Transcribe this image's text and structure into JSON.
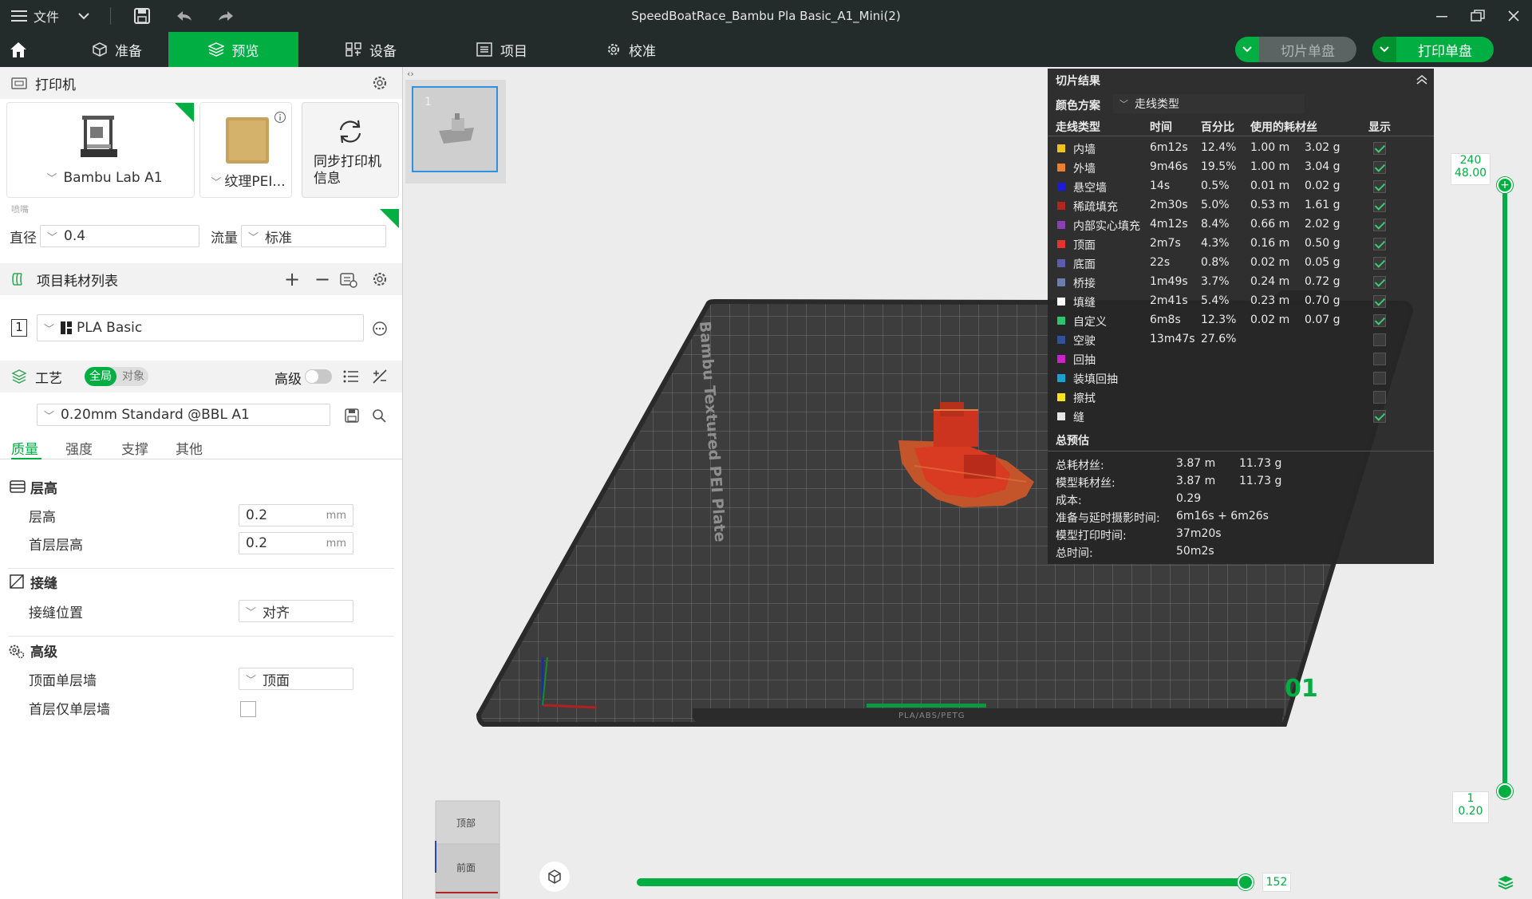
{
  "window": {
    "title": "SpeedBoatRace_Bambu Pla Basic_A1_Mini(2)",
    "file_menu": "文件"
  },
  "tabs": [
    {
      "label": "准备"
    },
    {
      "label": "预览"
    },
    {
      "label": "设备"
    },
    {
      "label": "项目"
    },
    {
      "label": "校准"
    }
  ],
  "actions": {
    "slice_label": "切片单盘",
    "print_label": "打印单盘"
  },
  "printer": {
    "section_title": "打印机",
    "printer_name": "Bambu Lab A1",
    "plate_name": "纹理PEI...",
    "sync_label": "同步打印机信息",
    "nozzle_caption": "喷嘴",
    "diameter_label": "直径",
    "diameter_value": "0.4",
    "flow_label": "流量",
    "flow_value": "标准"
  },
  "filament": {
    "section_title": "项目耗材列表",
    "slot": "1",
    "name": "PLA Basic"
  },
  "process": {
    "section_title": "工艺",
    "toggle_global": "全局",
    "toggle_object": "对象",
    "advanced_label": "高级",
    "preset": "0.20mm Standard @BBL A1",
    "subtabs": [
      "质量",
      "强度",
      "支撑",
      "其他"
    ],
    "layer_group": "层高",
    "layer_height_label": "层高",
    "layer_height_value": "0.2",
    "first_layer_label": "首层层高",
    "first_layer_value": "0.2",
    "unit": "mm",
    "seam_group": "接缝",
    "seam_label": "接缝位置",
    "seam_value": "对齐",
    "adv_group": "高级",
    "top_wall_label": "顶面单层墙",
    "top_wall_value": "顶面",
    "first_wall_label": "首层仅单层墙"
  },
  "plate": {
    "thumb_index": "1",
    "bed_label": "Bambu Textured PEI Plate",
    "plate_number": "01",
    "front_label": "PLA/ABS/PETG",
    "cube_top": "顶部",
    "cube_front": "前面"
  },
  "slice_result": {
    "title": "切片结果",
    "color_scheme_label": "颜色方案",
    "color_scheme_value": "走线类型",
    "headers": {
      "type": "走线类型",
      "time": "时间",
      "percent": "百分比",
      "used": "使用的耗材丝",
      "show": "显示"
    },
    "rows": [
      {
        "color": "#f2c21b",
        "name": "内墙",
        "time": "6m12s",
        "percent": "12.4%",
        "length": "1.00 m",
        "weight": "3.02 g",
        "shown": true
      },
      {
        "color": "#f07f2c",
        "name": "外墙",
        "time": "9m46s",
        "percent": "19.5%",
        "length": "1.00 m",
        "weight": "3.04 g",
        "shown": true
      },
      {
        "color": "#1b1bdb",
        "name": "悬空墙",
        "time": "14s",
        "percent": "0.5%",
        "length": "0.01 m",
        "weight": "0.02 g",
        "shown": true
      },
      {
        "color": "#b3261e",
        "name": "稀疏填充",
        "time": "2m30s",
        "percent": "5.0%",
        "length": "0.53 m",
        "weight": "1.61 g",
        "shown": true
      },
      {
        "color": "#8a3fb6",
        "name": "内部实心填充",
        "time": "4m12s",
        "percent": "8.4%",
        "length": "0.66 m",
        "weight": "2.02 g",
        "shown": true
      },
      {
        "color": "#e8322c",
        "name": "顶面",
        "time": "2m7s",
        "percent": "4.3%",
        "length": "0.16 m",
        "weight": "0.50 g",
        "shown": true
      },
      {
        "color": "#5b5bb0",
        "name": "底面",
        "time": "22s",
        "percent": "0.8%",
        "length": "0.02 m",
        "weight": "0.05 g",
        "shown": true
      },
      {
        "color": "#6b7fae",
        "name": "桥接",
        "time": "1m49s",
        "percent": "3.7%",
        "length": "0.24 m",
        "weight": "0.72 g",
        "shown": true
      },
      {
        "color": "#ffffff",
        "name": "填缝",
        "time": "2m41s",
        "percent": "5.4%",
        "length": "0.23 m",
        "weight": "0.70 g",
        "shown": true
      },
      {
        "color": "#2fc36e",
        "name": "自定义",
        "time": "6m8s",
        "percent": "12.3%",
        "length": "0.02 m",
        "weight": "0.07 g",
        "shown": true
      },
      {
        "color": "#3050a0",
        "name": "空驶",
        "time": "13m47s",
        "percent": "27.6%",
        "length": "",
        "weight": "",
        "shown": false
      },
      {
        "color": "#cc22cc",
        "name": "回抽",
        "time": "",
        "percent": "",
        "length": "",
        "weight": "",
        "shown": false
      },
      {
        "color": "#1a9fd6",
        "name": "装填回抽",
        "time": "",
        "percent": "",
        "length": "",
        "weight": "",
        "shown": false
      },
      {
        "color": "#f4e619",
        "name": "擦拭",
        "time": "",
        "percent": "",
        "length": "",
        "weight": "",
        "shown": false
      },
      {
        "color": "#e6e6e6",
        "name": "缝",
        "time": "",
        "percent": "",
        "length": "",
        "weight": "",
        "shown": true
      }
    ],
    "estimate_title": "总预估",
    "estimates": [
      {
        "label": "总耗材丝:",
        "a": "3.87 m",
        "b": "11.73 g"
      },
      {
        "label": "模型耗材丝:",
        "a": "3.87 m",
        "b": "11.73 g"
      },
      {
        "label": "成本:",
        "a": "0.29",
        "b": ""
      },
      {
        "label": "准备与延时摄影时间:",
        "a": "6m16s + 6m26s",
        "b": ""
      },
      {
        "label": "模型打印时间:",
        "a": "37m20s",
        "b": ""
      },
      {
        "label": "总时间:",
        "a": "50m2s",
        "b": ""
      }
    ]
  },
  "layer_slider": {
    "top_layer": "240",
    "top_height": "48.00",
    "bottom_layer": "1",
    "bottom_height": "0.20"
  },
  "move_slider": {
    "value": "152"
  },
  "colors": {
    "accent": "#00ae42",
    "titlebar": "#232b2b"
  }
}
